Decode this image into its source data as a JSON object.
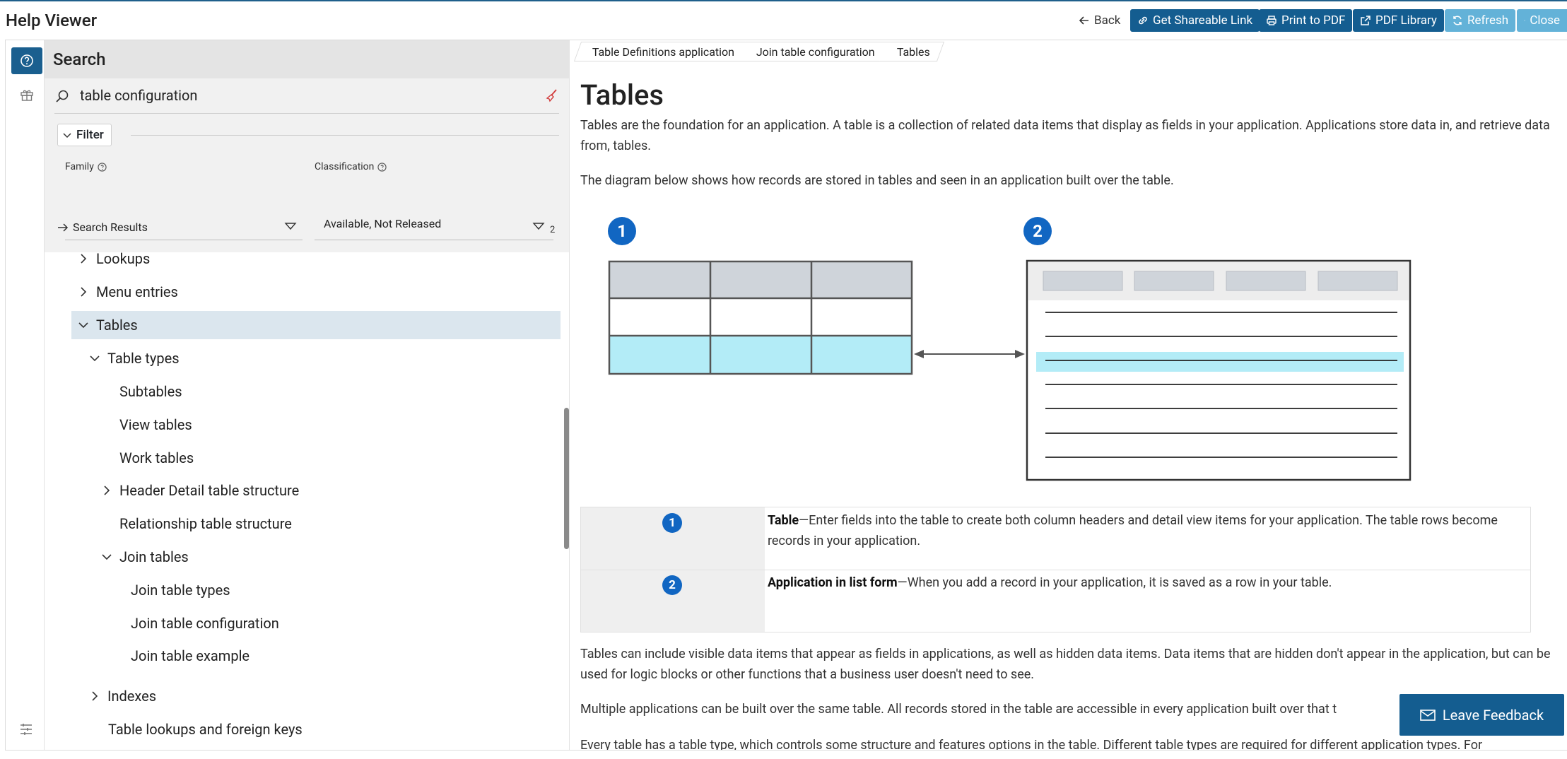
{
  "app": {
    "title": "Help Viewer"
  },
  "toolbar": {
    "back": "Back",
    "share": "Get Shareable Link",
    "print": "Print to PDF",
    "library": "PDF Library",
    "refresh": "Refresh",
    "close": "Close"
  },
  "search": {
    "title": "Search",
    "query": "table configuration",
    "filter_label": "Filter",
    "family_label": "Family",
    "family_value": "",
    "classification_label": "Classification",
    "classification_value": "Available, Not Released",
    "classification_count": "2",
    "results_label": "Search Results"
  },
  "tree": {
    "lookups": "Lookups",
    "menu_entries": "Menu entries",
    "tables": "Tables",
    "table_types": "Table types",
    "subtables": "Subtables",
    "view_tables": "View tables",
    "work_tables": "Work tables",
    "header_detail": "Header Detail table structure",
    "relationship": "Relationship table structure",
    "join_tables": "Join tables",
    "join_table_types": "Join table types",
    "join_table_configuration": "Join table configuration",
    "join_table_example": "Join table example",
    "indexes": "Indexes",
    "lookups_fk": "Table lookups and foreign keys"
  },
  "content": {
    "breadcrumbs": [
      "Table Definitions application",
      "Join table configuration",
      "Tables"
    ],
    "title": "Tables",
    "p1": "Tables are the foundation for an application. A table is a collection of related data items that display as fields in your application. Applications store data in, and retrieve data from, tables.",
    "p2": "The diagram below shows how records are stored in tables and seen in an application built over the table.",
    "badge1": "1",
    "badge2": "2",
    "row1_term": "Table",
    "row1_text": "—Enter fields into the table to create both column headers and detail view items for your application. The table rows become records in your application.",
    "row2_term": "Application in list form",
    "row2_text": "—When you add a record in your application, it is saved as a row in your table.",
    "p3": "Tables can include visible data items that appear as fields in applications, as well as hidden data items. Data items that are hidden don't appear in the application, but can be used for logic blocks or other functions that a business user doesn't need to see.",
    "p4": "Multiple applications can be built over the same table. All records stored in the table are accessible in every application built over that t",
    "p5": "Every table has a table type, which controls some structure and features options in the table. Different table types are required for different application types. For"
  },
  "feedback": {
    "label": "Leave Feedback"
  },
  "colors": {
    "brand_dark": "#145d90",
    "brand_light": "#63b2d8",
    "badge": "#1166c2",
    "highlight": "#b3ecf7"
  }
}
